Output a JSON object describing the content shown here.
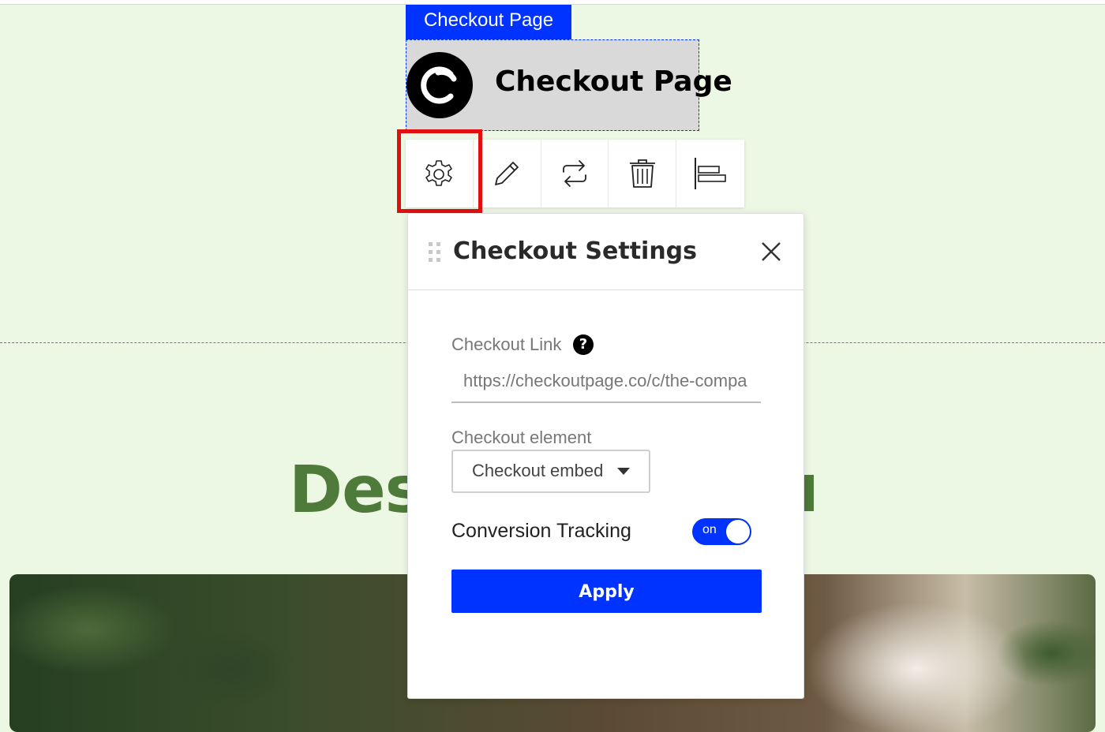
{
  "element": {
    "tag_label": "Checkout Page",
    "logo_text": "Checkout Page"
  },
  "toolbar": {
    "tools": [
      {
        "name": "settings",
        "icon": "gear-icon",
        "selected": true
      },
      {
        "name": "edit",
        "icon": "pencil-icon"
      },
      {
        "name": "swap",
        "icon": "swap-arrows-icon"
      },
      {
        "name": "delete",
        "icon": "trash-icon"
      },
      {
        "name": "align",
        "icon": "align-left-icon"
      }
    ]
  },
  "page": {
    "heading_fragment": "Des"
  },
  "settings_panel": {
    "title": "Checkout Settings",
    "checkout_link_label": "Checkout Link",
    "help_glyph": "?",
    "checkout_link_value": "https://checkoutpage.co/c/the-compa",
    "checkout_element_label": "Checkout element",
    "checkout_element_value": "Checkout embed",
    "conversion_tracking_label": "Conversion Tracking",
    "conversion_tracking_state": "on",
    "apply_label": "Apply"
  },
  "colors": {
    "accent": "#0033ff",
    "page_bg": "#edf8e4",
    "heading": "#4e7a3a",
    "highlight": "#e01010"
  }
}
